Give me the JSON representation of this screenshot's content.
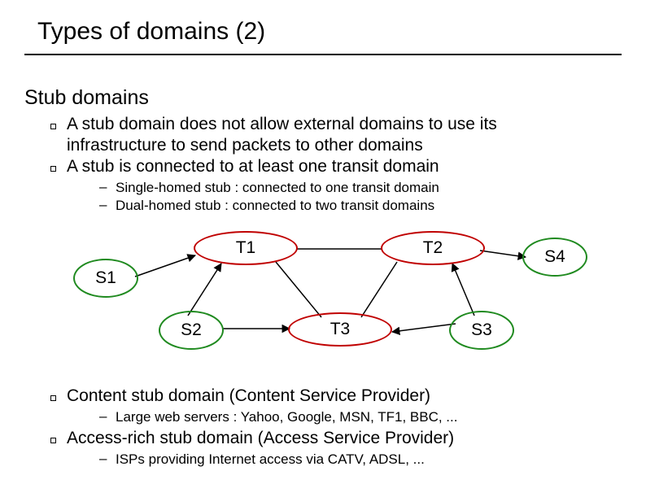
{
  "title": "Types of domains (2)",
  "subtitle": "Stub domains",
  "bullets": {
    "b1": "A stub domain does not allow external domains to use its infrastructure to send packets to other domains",
    "b2": "A stub is connected to at least one transit domain",
    "s1": "Single-homed stub : connected to one transit domain",
    "s2": "Dual-homed stub : connected to two transit domains",
    "b3": "Content stub domain (Content Service Provider)",
    "s3": "Large web servers : Yahoo, Google, MSN, TF1, BBC, ...",
    "b4": "Access-rich stub domain (Access Service Provider)",
    "s4": "ISPs providing Internet access via CATV, ADSL, ..."
  },
  "nodes": {
    "T1": "T1",
    "T2": "T2",
    "T3": "T3",
    "S1": "S1",
    "S2": "S2",
    "S3": "S3",
    "S4": "S4"
  }
}
